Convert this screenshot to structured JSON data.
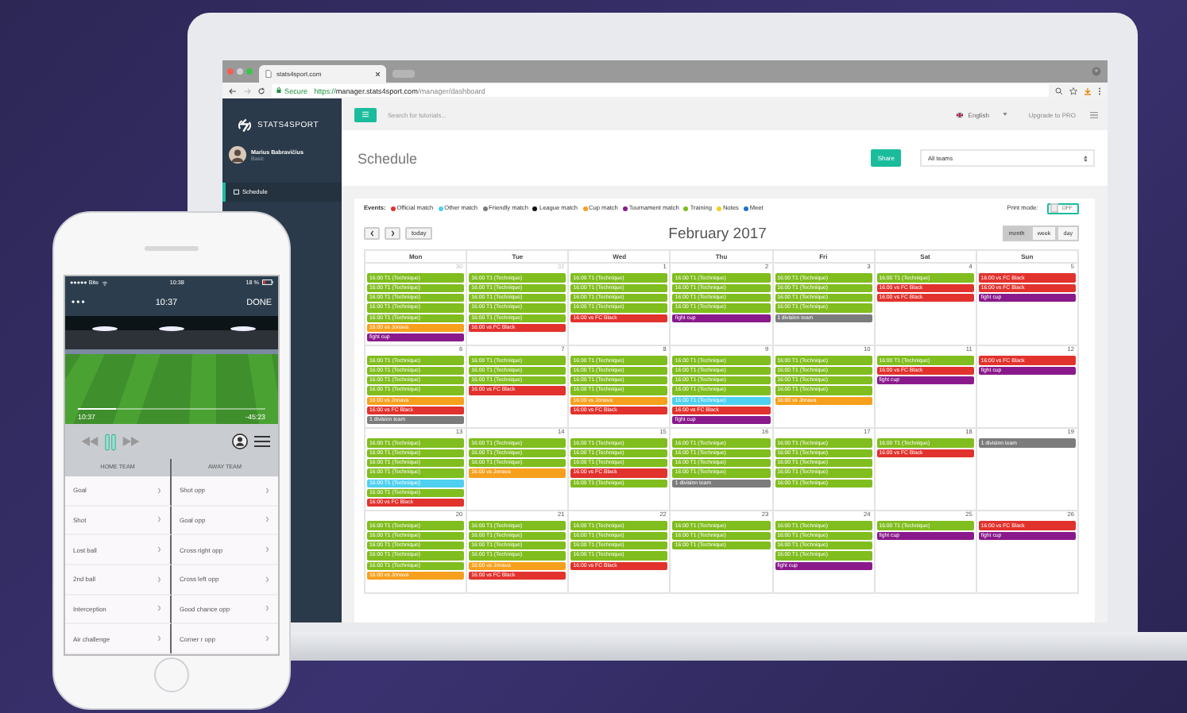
{
  "browser": {
    "tab_title": "stats4sport.com",
    "secure_label": "Secure",
    "url_scheme": "https://",
    "url_host": "manager.stats4sport.com",
    "url_path": "/manager/dashboard"
  },
  "sidebar": {
    "brand": "STATS4SPORT",
    "user_name": "Marius Babravičius",
    "user_plan": "Basic",
    "items": [
      {
        "label": "Schedule",
        "selected": true
      }
    ]
  },
  "topbar": {
    "search_placeholder": "Search for tutorials...",
    "language": "English",
    "upgrade": "Upgrade to PRO"
  },
  "header": {
    "title": "Schedule",
    "share": "Share",
    "team_select": "All teams"
  },
  "legend": {
    "label": "Events:",
    "items": [
      {
        "label": "Official match",
        "color": "#e2322d"
      },
      {
        "label": "Other match",
        "color": "#4fd0f0"
      },
      {
        "label": "Friendly match",
        "color": "#7c7c7c"
      },
      {
        "label": "League match",
        "color": "#111111"
      },
      {
        "label": "Cup match",
        "color": "#f7a01d"
      },
      {
        "label": "Tournament match",
        "color": "#8a1a8c"
      },
      {
        "label": "Training",
        "color": "#80bd1e"
      },
      {
        "label": "Notes",
        "color": "#f1d21c"
      },
      {
        "label": "Meet",
        "color": "#1e73c8"
      }
    ]
  },
  "print_mode": {
    "label": "Print mode:",
    "state_text": "OFF",
    "on": false
  },
  "calendar": {
    "today": "today",
    "month_title": "February 2017",
    "views": [
      {
        "label": "month",
        "selected": true
      },
      {
        "label": "week",
        "selected": false
      },
      {
        "label": "day",
        "selected": false
      }
    ],
    "weekdays": [
      "Mon",
      "Tue",
      "Wed",
      "Thu",
      "Fri",
      "Sat",
      "Sun"
    ],
    "weeks": [
      [
        {
          "num": "30",
          "other_month": true,
          "events": [
            {
              "color": "#80bd1e",
              "label": "16:00 T1 (Technique)"
            },
            {
              "color": "#80bd1e",
              "label": "16:00 T1 (Technique)"
            },
            {
              "color": "#80bd1e",
              "label": "16:00 T1 (Technique)"
            },
            {
              "color": "#80bd1e",
              "label": "16:00 T1 (Technique)"
            },
            {
              "color": "#80bd1e",
              "label": "16:00 T1 (Technique)"
            },
            {
              "color": "#f7a01d",
              "label": "16:00 vs Jonava"
            },
            {
              "color": "#8a1a8c",
              "label": "fight cup"
            }
          ]
        },
        {
          "num": "31",
          "other_month": true,
          "events": [
            {
              "color": "#80bd1e",
              "label": "16:00 T1 (Technique)"
            },
            {
              "color": "#80bd1e",
              "label": "16:00 T1 (Technique)"
            },
            {
              "color": "#80bd1e",
              "label": "16:00 T1 (Technique)"
            },
            {
              "color": "#80bd1e",
              "label": "16:00 T1 (Technique)"
            },
            {
              "color": "#80bd1e",
              "label": "16:00 T1 (Technique)"
            },
            {
              "color": "#e2322d",
              "label": "16:00 vs FC Black"
            }
          ]
        },
        {
          "num": "1",
          "other_month": false,
          "events": [
            {
              "color": "#80bd1e",
              "label": "16:00 T1 (Technique)"
            },
            {
              "color": "#80bd1e",
              "label": "16:00 T1 (Technique)"
            },
            {
              "color": "#80bd1e",
              "label": "16:00 T1 (Technique)"
            },
            {
              "color": "#80bd1e",
              "label": "16:00 T1 (Technique)"
            },
            {
              "color": "#e2322d",
              "label": "16:00 vs FC Black"
            }
          ]
        },
        {
          "num": "2",
          "other_month": false,
          "events": [
            {
              "color": "#80bd1e",
              "label": "16:00 T1 (Technique)"
            },
            {
              "color": "#80bd1e",
              "label": "16:00 T1 (Technique)"
            },
            {
              "color": "#80bd1e",
              "label": "16:00 T1 (Technique)"
            },
            {
              "color": "#80bd1e",
              "label": "16:00 T1 (Technique)"
            },
            {
              "color": "#8a1a8c",
              "label": "fight cup"
            }
          ]
        },
        {
          "num": "3",
          "other_month": false,
          "events": [
            {
              "color": "#80bd1e",
              "label": "16:00 T1 (Technique)"
            },
            {
              "color": "#80bd1e",
              "label": "16:00 T1 (Technique)"
            },
            {
              "color": "#80bd1e",
              "label": "16:00 T1 (Technique)"
            },
            {
              "color": "#80bd1e",
              "label": "16:00 T1 (Technique)"
            },
            {
              "color": "#7c7c7c",
              "label": "1 division team"
            }
          ]
        },
        {
          "num": "4",
          "other_month": false,
          "events": [
            {
              "color": "#80bd1e",
              "label": "16:00 T1 (Technique)"
            },
            {
              "color": "#e2322d",
              "label": "16:00 vs FC Black"
            },
            {
              "color": "#e2322d",
              "label": "16:00 vs FC Black"
            }
          ]
        },
        {
          "num": "5",
          "other_month": false,
          "events": [
            {
              "color": "#e2322d",
              "label": "16:00 vs FC Black"
            },
            {
              "color": "#e2322d",
              "label": "16:00 vs FC Black"
            },
            {
              "color": "#8a1a8c",
              "label": "fight cup"
            }
          ]
        }
      ],
      [
        {
          "num": "6",
          "other_month": false,
          "events": [
            {
              "color": "#80bd1e",
              "label": "16:00 T1 (Technique)"
            },
            {
              "color": "#80bd1e",
              "label": "16:00 T1 (Technique)"
            },
            {
              "color": "#80bd1e",
              "label": "16:00 T1 (Technique)"
            },
            {
              "color": "#80bd1e",
              "label": "16:00 T1 (Technique)"
            },
            {
              "color": "#f7a01d",
              "label": "16:00 vs Jonava"
            },
            {
              "color": "#e2322d",
              "label": "16:00 vs FC Black"
            },
            {
              "color": "#7c7c7c",
              "label": "1 division team"
            }
          ]
        },
        {
          "num": "7",
          "other_month": false,
          "events": [
            {
              "color": "#80bd1e",
              "label": "16:00 T1 (Technique)"
            },
            {
              "color": "#80bd1e",
              "label": "16:00 T1 (Technique)"
            },
            {
              "color": "#80bd1e",
              "label": "16:00 T1 (Technique)"
            },
            {
              "color": "#e2322d",
              "label": "16:00 vs FC Black"
            }
          ]
        },
        {
          "num": "8",
          "other_month": false,
          "events": [
            {
              "color": "#80bd1e",
              "label": "16:00 T1 (Technique)"
            },
            {
              "color": "#80bd1e",
              "label": "16:00 T1 (Technique)"
            },
            {
              "color": "#80bd1e",
              "label": "16:00 T1 (Technique)"
            },
            {
              "color": "#80bd1e",
              "label": "16:00 T1 (Technique)"
            },
            {
              "color": "#f7a01d",
              "label": "16:00 vs Jonava"
            },
            {
              "color": "#e2322d",
              "label": "16:00 vs FC Black"
            }
          ]
        },
        {
          "num": "9",
          "other_month": false,
          "events": [
            {
              "color": "#80bd1e",
              "label": "16:00 T1 (Technique)"
            },
            {
              "color": "#80bd1e",
              "label": "16:00 T1 (Technique)"
            },
            {
              "color": "#80bd1e",
              "label": "16:00 T1 (Technique)"
            },
            {
              "color": "#80bd1e",
              "label": "16:00 T1 (Technique)"
            },
            {
              "color": "#4fd0f0",
              "label": "16:00 T1 (Technique)"
            },
            {
              "color": "#e2322d",
              "label": "16:00 vs FC Black"
            },
            {
              "color": "#8a1a8c",
              "label": "fight cup"
            }
          ]
        },
        {
          "num": "10",
          "other_month": false,
          "events": [
            {
              "color": "#80bd1e",
              "label": "16:00 T1 (Technique)"
            },
            {
              "color": "#80bd1e",
              "label": "16:00 T1 (Technique)"
            },
            {
              "color": "#80bd1e",
              "label": "16:00 T1 (Technique)"
            },
            {
              "color": "#80bd1e",
              "label": "16:00 T1 (Technique)"
            },
            {
              "color": "#f7a01d",
              "label": "16:00 vs Jonava"
            }
          ]
        },
        {
          "num": "11",
          "other_month": false,
          "events": [
            {
              "color": "#80bd1e",
              "label": "16:00 T1 (Technique)"
            },
            {
              "color": "#e2322d",
              "label": "16:00 vs FC Black"
            },
            {
              "color": "#8a1a8c",
              "label": "fight cup"
            }
          ]
        },
        {
          "num": "12",
          "other_month": false,
          "events": [
            {
              "color": "#e2322d",
              "label": "16:00 vs FC Black"
            },
            {
              "color": "#8a1a8c",
              "label": "fight cup"
            }
          ]
        }
      ],
      [
        {
          "num": "13",
          "other_month": false,
          "events": [
            {
              "color": "#80bd1e",
              "label": "16:00 T1 (Technique)"
            },
            {
              "color": "#80bd1e",
              "label": "16:00 T1 (Technique)"
            },
            {
              "color": "#80bd1e",
              "label": "16:00 T1 (Technique)"
            },
            {
              "color": "#80bd1e",
              "label": "16:00 T1 (Technique)"
            },
            {
              "color": "#4fd0f0",
              "label": "16:00 T1 (Technique)"
            },
            {
              "color": "#80bd1e",
              "label": "16:00 T1 (Technique)"
            },
            {
              "color": "#e2322d",
              "label": "16:00 vs FC Black"
            }
          ]
        },
        {
          "num": "14",
          "other_month": false,
          "events": [
            {
              "color": "#80bd1e",
              "label": "16:00 T1 (Technique)"
            },
            {
              "color": "#80bd1e",
              "label": "16:00 T1 (Technique)"
            },
            {
              "color": "#80bd1e",
              "label": "16:00 T1 (Technique)"
            },
            {
              "color": "#f7a01d",
              "label": "16:00 vs Jonava"
            }
          ]
        },
        {
          "num": "15",
          "other_month": false,
          "events": [
            {
              "color": "#80bd1e",
              "label": "16:00 T1 (Technique)"
            },
            {
              "color": "#80bd1e",
              "label": "16:00 T1 (Technique)"
            },
            {
              "color": "#80bd1e",
              "label": "16:00 T1 (Technique)"
            },
            {
              "color": "#e2322d",
              "label": "16:00 vs FC Black"
            },
            {
              "color": "#80bd1e",
              "label": "16:00 T1 (Technique)"
            }
          ]
        },
        {
          "num": "16",
          "other_month": false,
          "events": [
            {
              "color": "#80bd1e",
              "label": "16:00 T1 (Technique)"
            },
            {
              "color": "#80bd1e",
              "label": "16:00 T1 (Technique)"
            },
            {
              "color": "#80bd1e",
              "label": "16:00 T1 (Technique)"
            },
            {
              "color": "#80bd1e",
              "label": "16:00 T1 (Technique)"
            },
            {
              "color": "#7c7c7c",
              "label": "1 division team"
            }
          ]
        },
        {
          "num": "17",
          "other_month": false,
          "events": [
            {
              "color": "#80bd1e",
              "label": "16:00 T1 (Technique)"
            },
            {
              "color": "#80bd1e",
              "label": "16:00 T1 (Technique)"
            },
            {
              "color": "#80bd1e",
              "label": "16:00 T1 (Technique)"
            },
            {
              "color": "#80bd1e",
              "label": "16:00 T1 (Technique)"
            },
            {
              "color": "#80bd1e",
              "label": "16:00 T1 (Technique)"
            }
          ]
        },
        {
          "num": "18",
          "other_month": false,
          "events": [
            {
              "color": "#80bd1e",
              "label": "16:00 T1 (Technique)"
            },
            {
              "color": "#e2322d",
              "label": "16:00 vs FC Black"
            }
          ]
        },
        {
          "num": "19",
          "other_month": false,
          "events": [
            {
              "color": "#7c7c7c",
              "label": "1 division team"
            }
          ]
        }
      ],
      [
        {
          "num": "20",
          "other_month": false,
          "events": [
            {
              "color": "#80bd1e",
              "label": "16:00 T1 (Technique)"
            },
            {
              "color": "#80bd1e",
              "label": "16:00 T1 (Technique)"
            },
            {
              "color": "#80bd1e",
              "label": "16:00 T1 (Technique)"
            },
            {
              "color": "#80bd1e",
              "label": "16:00 T1 (Technique)"
            },
            {
              "color": "#80bd1e",
              "label": "16:00 T1 (Technique)"
            },
            {
              "color": "#f7a01d",
              "label": "16:00 vs Jonava"
            }
          ]
        },
        {
          "num": "21",
          "other_month": false,
          "events": [
            {
              "color": "#80bd1e",
              "label": "16:00 T1 (Technique)"
            },
            {
              "color": "#80bd1e",
              "label": "16:00 T1 (Technique)"
            },
            {
              "color": "#80bd1e",
              "label": "16:00 T1 (Technique)"
            },
            {
              "color": "#80bd1e",
              "label": "16:00 T1 (Technique)"
            },
            {
              "color": "#f7a01d",
              "label": "16:00 vs Jonava"
            },
            {
              "color": "#e2322d",
              "label": "16:00 vs FC Black"
            }
          ]
        },
        {
          "num": "22",
          "other_month": false,
          "events": [
            {
              "color": "#80bd1e",
              "label": "16:00 T1 (Technique)"
            },
            {
              "color": "#80bd1e",
              "label": "16:00 T1 (Technique)"
            },
            {
              "color": "#80bd1e",
              "label": "16:00 T1 (Technique)"
            },
            {
              "color": "#80bd1e",
              "label": "16:00 T1 (Technique)"
            },
            {
              "color": "#e2322d",
              "label": "16:00 vs FC Black"
            }
          ]
        },
        {
          "num": "23",
          "other_month": false,
          "events": [
            {
              "color": "#80bd1e",
              "label": "16:00 T1 (Technique)"
            },
            {
              "color": "#80bd1e",
              "label": "16:00 T1 (Technique)"
            },
            {
              "color": "#80bd1e",
              "label": "16:00 T1 (Technique)"
            }
          ]
        },
        {
          "num": "24",
          "other_month": false,
          "events": [
            {
              "color": "#80bd1e",
              "label": "16:00 T1 (Technique)"
            },
            {
              "color": "#80bd1e",
              "label": "16:00 T1 (Technique)"
            },
            {
              "color": "#80bd1e",
              "label": "16:00 T1 (Technique)"
            },
            {
              "color": "#80bd1e",
              "label": "16:00 T1 (Technique)"
            },
            {
              "color": "#8a1a8c",
              "label": "fight cup"
            }
          ]
        },
        {
          "num": "25",
          "other_month": false,
          "events": [
            {
              "color": "#80bd1e",
              "label": "16:00 T1 (Technique)"
            },
            {
              "color": "#8a1a8c",
              "label": "fight cup"
            }
          ]
        },
        {
          "num": "26",
          "other_month": false,
          "events": [
            {
              "color": "#e2322d",
              "label": "16:00 vs FC Black"
            },
            {
              "color": "#8a1a8c",
              "label": "fight cup"
            }
          ]
        }
      ]
    ]
  },
  "phone": {
    "carrier": "●●●●● Bite",
    "status_time": "10:38",
    "battery": "18 %",
    "nav_more": "•••",
    "nav_time": "10:37",
    "done": "DONE",
    "video": {
      "kind": "picture",
      "elapsed": "10:37",
      "remaining": "-45:23",
      "level": 0.2
    },
    "columns": [
      "HOME TEAM",
      "AWAY TEAM"
    ],
    "rows": [
      [
        "Goal",
        "Shot opp"
      ],
      [
        "Shot",
        "Goal opp"
      ],
      [
        "Lost ball",
        "Cross right opp"
      ],
      [
        "2nd ball",
        "Cross left opp"
      ],
      [
        "Interception",
        "Good chance opp"
      ],
      [
        "Air challenge",
        "Corner r opp"
      ]
    ]
  }
}
